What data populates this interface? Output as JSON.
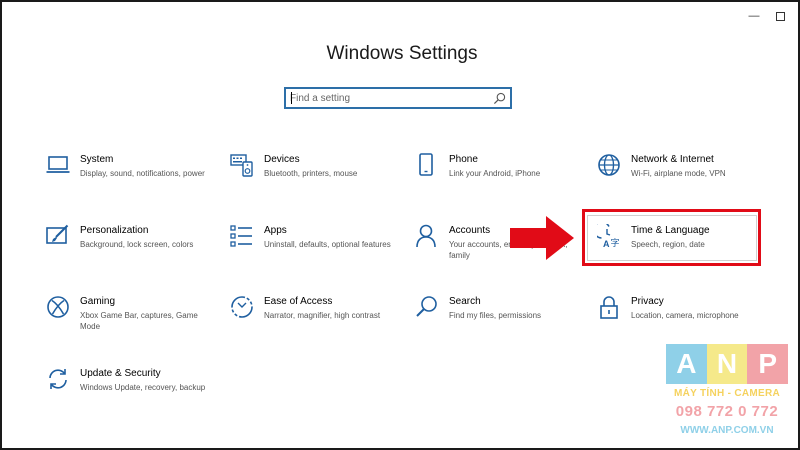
{
  "window": {
    "title": "Windows Settings",
    "minimize_glyph": "—",
    "maximize_glyph": ""
  },
  "search": {
    "placeholder": "Find a setting",
    "icon": "search-icon"
  },
  "tiles": [
    {
      "name": "System",
      "desc": "Display, sound, notifications, power",
      "icon": "laptop-icon"
    },
    {
      "name": "Devices",
      "desc": "Bluetooth, printers, mouse",
      "icon": "keyboard-speaker-icon"
    },
    {
      "name": "Phone",
      "desc": "Link your Android, iPhone",
      "icon": "phone-icon"
    },
    {
      "name": "Network & Internet",
      "desc": "Wi-Fi, airplane mode, VPN",
      "icon": "globe-icon"
    },
    {
      "name": "Personalization",
      "desc": "Background, lock screen, colors",
      "icon": "paint-monitor-icon"
    },
    {
      "name": "Apps",
      "desc": "Uninstall, defaults, optional features",
      "icon": "apps-list-icon"
    },
    {
      "name": "Accounts",
      "desc": "Your accounts, email, sync, work, family",
      "icon": "person-icon"
    },
    {
      "name": "Time & Language",
      "desc": "Speech, region, date",
      "icon": "time-language-icon"
    },
    {
      "name": "Gaming",
      "desc": "Xbox Game Bar, captures, Game Mode",
      "icon": "xbox-icon"
    },
    {
      "name": "Ease of Access",
      "desc": "Narrator, magnifier, high contrast",
      "icon": "ease-of-access-icon"
    },
    {
      "name": "Search",
      "desc": "Find my files, permissions",
      "icon": "magnifier-icon"
    },
    {
      "name": "Privacy",
      "desc": "Location, camera, microphone",
      "icon": "lock-icon"
    },
    {
      "name": "Update & Security",
      "desc": "Windows Update, recovery, backup",
      "icon": "sync-arrows-icon"
    }
  ],
  "annotation": {
    "highlight_color": "#e10b17",
    "arrow_color": "#e10b17"
  },
  "watermark": {
    "letters": [
      "A",
      "N",
      "P"
    ],
    "subtitle": "MÁY TÍNH - CAMERA",
    "phone": "098 772 0 772",
    "url": "WWW.ANP.COM.VN"
  },
  "colors": {
    "icon_blue": "#1f5fa0",
    "search_border": "#2d6fa8"
  }
}
